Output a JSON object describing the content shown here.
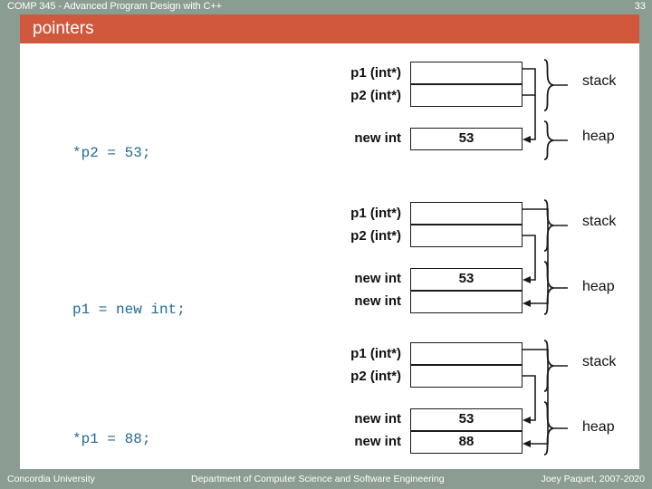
{
  "header": {
    "course": "COMP 345 - Advanced Program Design with C++",
    "slide_number": "33"
  },
  "title": "pointers",
  "footer": {
    "left": "Concordia University",
    "center": "Department of Computer Science and Software Engineering",
    "right": "Joey Paquet, 2007-2020"
  },
  "colors": {
    "accent": "#d1573d",
    "chrome": "#8b9d92",
    "code": "#1f6a94",
    "ink": "#1a1a1a",
    "paper": "#ffffff"
  },
  "steps": [
    {
      "code": "*p2 = 53;",
      "stack": {
        "region_label": "stack",
        "rows": [
          {
            "label": "p1 (int*)",
            "value": ""
          },
          {
            "label": "p2 (int*)",
            "value": ""
          }
        ]
      },
      "heap": {
        "region_label": "heap",
        "rows": [
          {
            "label": "new int",
            "value": "53"
          }
        ]
      }
    },
    {
      "code": "p1 = new int;",
      "stack": {
        "region_label": "stack",
        "rows": [
          {
            "label": "p1 (int*)",
            "value": ""
          },
          {
            "label": "p2 (int*)",
            "value": ""
          }
        ]
      },
      "heap": {
        "region_label": "heap",
        "rows": [
          {
            "label": "new int",
            "value": "53"
          },
          {
            "label": "new int",
            "value": ""
          }
        ]
      }
    },
    {
      "code": "*p1 = 88;",
      "stack": {
        "region_label": "stack",
        "rows": [
          {
            "label": "p1 (int*)",
            "value": ""
          },
          {
            "label": "p2 (int*)",
            "value": ""
          }
        ]
      },
      "heap": {
        "region_label": "heap",
        "rows": [
          {
            "label": "new int",
            "value": "53"
          },
          {
            "label": "new int",
            "value": "88"
          }
        ]
      }
    }
  ]
}
